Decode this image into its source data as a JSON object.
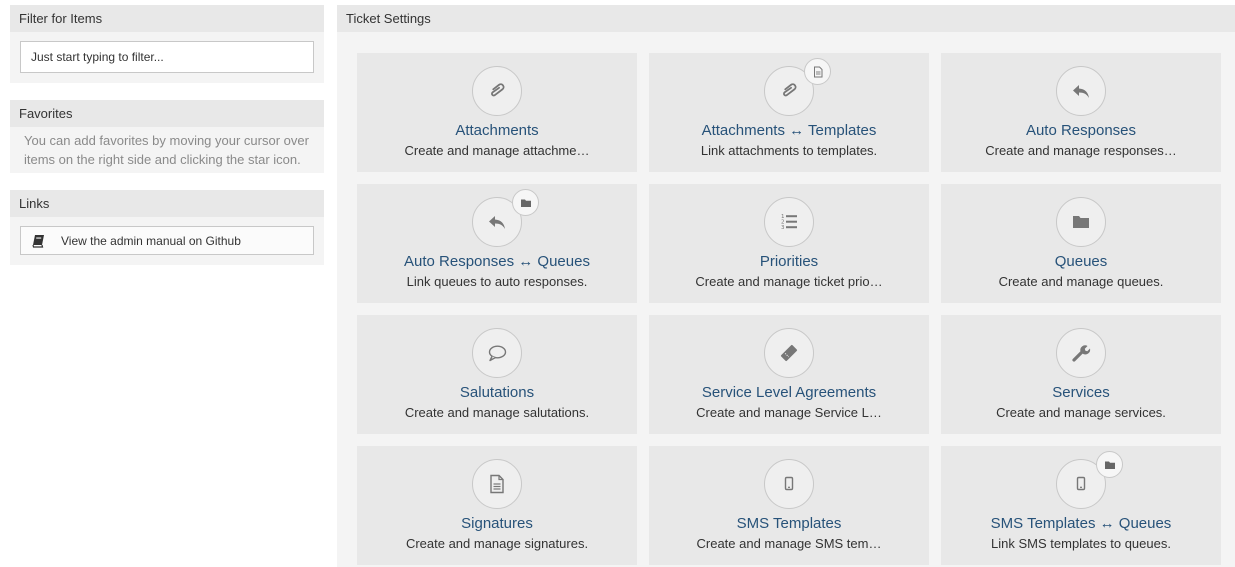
{
  "sidebar": {
    "filter": {
      "title": "Filter for Items",
      "placeholder": "Just start typing to filter..."
    },
    "favorites": {
      "title": "Favorites",
      "text": "You can add favorites by moving your cursor over items on the right side and clicking the star icon."
    },
    "links": {
      "title": "Links",
      "items": [
        {
          "label": "View the admin manual on Github",
          "icon": "book-icon"
        }
      ]
    }
  },
  "main": {
    "title": "Ticket Settings",
    "tiles": [
      {
        "title": "Attachments",
        "description": "Create and manage attachme…",
        "icon": "paperclip-icon"
      },
      {
        "title": "Attachments ↔ Templates",
        "description": "Link attachments to templates.",
        "icon": "paperclip-icon",
        "badge": "document-icon"
      },
      {
        "title": "Auto Responses",
        "description": "Create and manage responses…",
        "icon": "reply-icon"
      },
      {
        "title": "Auto Responses ↔ Queues",
        "description": "Link queues to auto responses.",
        "icon": "reply-icon",
        "badge": "folder-icon"
      },
      {
        "title": "Priorities",
        "description": "Create and manage ticket prio…",
        "icon": "numbered-list-icon"
      },
      {
        "title": "Queues",
        "description": "Create and manage queues.",
        "icon": "folder-icon"
      },
      {
        "title": "Salutations",
        "description": "Create and manage salutations.",
        "icon": "speech-bubble-icon"
      },
      {
        "title": "Service Level Agreements",
        "description": "Create and manage Service L…",
        "icon": "ticket-icon"
      },
      {
        "title": "Services",
        "description": "Create and manage services.",
        "icon": "wrench-icon"
      },
      {
        "title": "Signatures",
        "description": "Create and manage signatures.",
        "icon": "document-icon"
      },
      {
        "title": "SMS Templates",
        "description": "Create and manage SMS tem…",
        "icon": "mobile-phone-icon"
      },
      {
        "title": "SMS Templates ↔ Queues",
        "description": "Link SMS templates to queues.",
        "icon": "mobile-phone-icon",
        "badge": "folder-icon"
      }
    ]
  },
  "colors": {
    "link": "#275279",
    "tile_bg": "#e8e8e8",
    "panel_bg": "#f4f4f4",
    "icon": "#777777"
  }
}
